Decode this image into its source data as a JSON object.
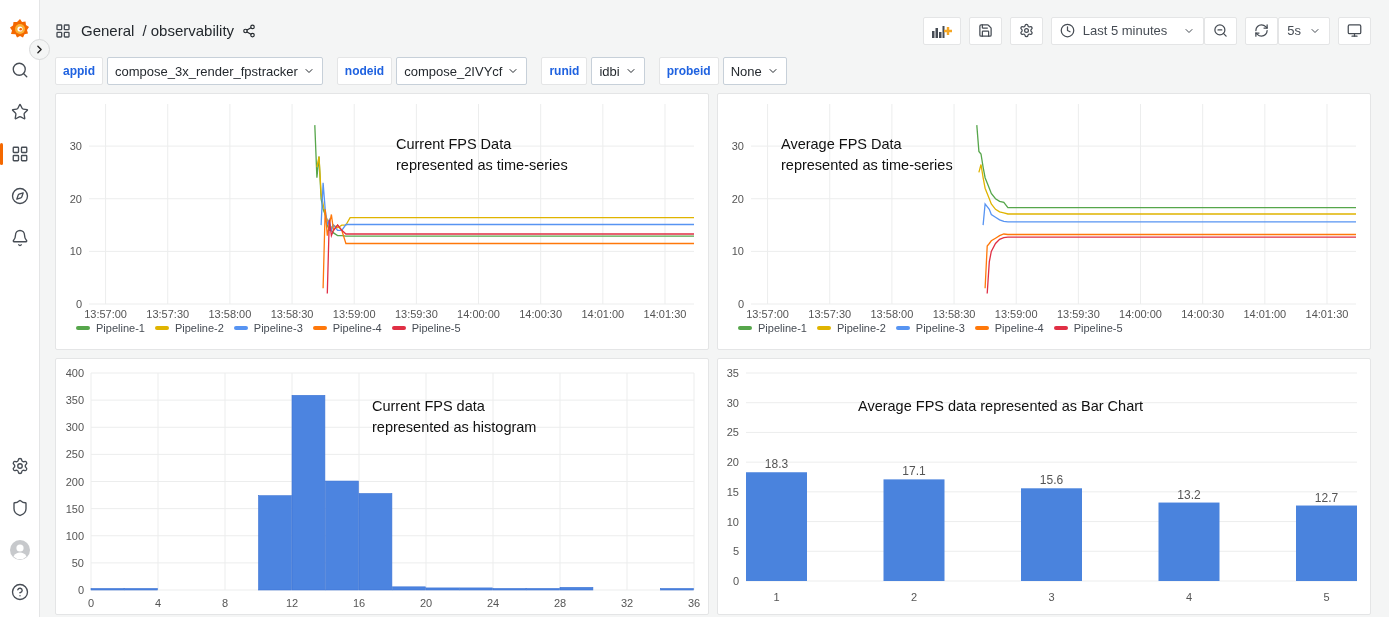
{
  "sidebar": {
    "items": [
      {
        "kind": "search",
        "selected": false
      },
      {
        "kind": "starred",
        "selected": false
      },
      {
        "kind": "dashboards",
        "selected": true
      },
      {
        "kind": "explore",
        "selected": false
      },
      {
        "kind": "alerting",
        "selected": false
      }
    ],
    "bottom_items": [
      {
        "kind": "settings"
      },
      {
        "kind": "shield"
      },
      {
        "kind": "profile"
      },
      {
        "kind": "help"
      }
    ]
  },
  "header": {
    "folder": "General",
    "dashboard": "/ observability"
  },
  "toolbar": {
    "time_range": "Last 5 minutes",
    "refresh_interval": "5s"
  },
  "variables": [
    {
      "name": "appid",
      "value": "compose_3x_render_fpstracker"
    },
    {
      "name": "nodeid",
      "value": "compose_2IVYcf"
    },
    {
      "name": "runid",
      "value": "idbi"
    },
    {
      "name": "probeid",
      "value": "None"
    }
  ],
  "panels": [
    {
      "annotation": "Current FPS Data\nrepresented as time-series",
      "chart_data": {
        "type": "line",
        "grid": true,
        "x": [
          50321,
          50322,
          50323,
          50324,
          50325,
          50326,
          50327,
          50328,
          50329,
          50330,
          50332,
          50334,
          50336,
          50338,
          50340,
          50504
        ],
        "xlim": [
          50212,
          50504
        ],
        "ylim": [
          0,
          38
        ],
        "yticks": [
          0,
          10,
          20,
          30
        ],
        "xticks": [
          {
            "value": 50220,
            "label": "13:57:00"
          },
          {
            "value": 50250,
            "label": "13:57:30"
          },
          {
            "value": 50280,
            "label": "13:58:00"
          },
          {
            "value": 50310,
            "label": "13:58:30"
          },
          {
            "value": 50340,
            "label": "13:59:00"
          },
          {
            "value": 50370,
            "label": "13:59:30"
          },
          {
            "value": 50400,
            "label": "14:00:00"
          },
          {
            "value": 50430,
            "label": "14:00:30"
          },
          {
            "value": 50460,
            "label": "14:01:00"
          },
          {
            "value": 50490,
            "label": "14:01:30"
          }
        ],
        "series": [
          {
            "name": "Pipeline-1",
            "color": "#56a64b",
            "values": [
              34,
              24,
              28,
              20,
              18,
              17,
              15,
              14,
              14,
              13.5,
              13,
              13,
              12.9,
              12.9,
              12.9,
              12.9
            ]
          },
          {
            "name": "Pipeline-2",
            "color": "#e0b400",
            "values": [
              null,
              26,
              28,
              21,
              19,
              17,
              16,
              15,
              14.5,
              15,
              14.5,
              15,
              15,
              16.4,
              16.4,
              16.4
            ]
          },
          {
            "name": "Pipeline-3",
            "color": "#5794f2",
            "values": [
              null,
              null,
              null,
              15,
              23,
              18,
              15,
              16,
              14,
              15,
              14,
              14,
              15.1,
              15.1,
              15.1,
              15.1
            ]
          },
          {
            "name": "Pipeline-4",
            "color": "#ff780a",
            "values": [
              null,
              null,
              null,
              null,
              3,
              18,
              13,
              15,
              17,
              14,
              15,
              14,
              11.5,
              11.5,
              11.5,
              11.5
            ]
          },
          {
            "name": "Pipeline-5",
            "color": "#e02f44",
            "values": [
              null,
              null,
              null,
              null,
              null,
              null,
              2,
              16,
              13,
              14,
              15,
              14,
              13.3,
              13.3,
              13.3,
              13.3
            ]
          }
        ]
      }
    },
    {
      "annotation": "Average FPS Data\nrepresented as time-series",
      "chart_data": {
        "type": "line",
        "grid": true,
        "x": [
          50321,
          50322,
          50323,
          50324,
          50325,
          50326,
          50327,
          50328,
          50330,
          50332,
          50334,
          50336,
          50338,
          50504
        ],
        "xlim": [
          50212,
          50504
        ],
        "ylim": [
          0,
          38
        ],
        "yticks": [
          0,
          10,
          20,
          30
        ],
        "xticks": [
          {
            "value": 50220,
            "label": "13:57:00"
          },
          {
            "value": 50250,
            "label": "13:57:30"
          },
          {
            "value": 50280,
            "label": "13:58:00"
          },
          {
            "value": 50310,
            "label": "13:58:30"
          },
          {
            "value": 50340,
            "label": "13:59:00"
          },
          {
            "value": 50370,
            "label": "13:59:30"
          },
          {
            "value": 50400,
            "label": "14:00:00"
          },
          {
            "value": 50430,
            "label": "14:00:30"
          },
          {
            "value": 50460,
            "label": "14:01:00"
          },
          {
            "value": 50490,
            "label": "14:01:30"
          }
        ],
        "series": [
          {
            "name": "Pipeline-1",
            "color": "#56a64b",
            "values": [
              34,
              29,
              28.5,
              26,
              24,
              23,
              22,
              21,
              20,
              19.5,
              19.3,
              18.3,
              18.3,
              18.3
            ]
          },
          {
            "name": "Pipeline-2",
            "color": "#e0b400",
            "values": [
              null,
              25,
              26.5,
              24,
              22,
              21,
              20,
              19,
              18,
              17.5,
              17.3,
              17.1,
              17.1,
              17.1
            ]
          },
          {
            "name": "Pipeline-3",
            "color": "#5794f2",
            "values": [
              null,
              null,
              null,
              15,
              19,
              18.5,
              18,
              17,
              16.5,
              16,
              15.7,
              15.6,
              15.6,
              15.6
            ]
          },
          {
            "name": "Pipeline-4",
            "color": "#ff780a",
            "values": [
              null,
              null,
              null,
              null,
              3,
              11,
              11.5,
              12,
              12.5,
              13,
              13.3,
              13.2,
              13.2,
              13.2
            ]
          },
          {
            "name": "Pipeline-5",
            "color": "#e02f44",
            "values": [
              null,
              null,
              null,
              null,
              null,
              2,
              8,
              10,
              11.5,
              12.3,
              12.6,
              12.7,
              12.7,
              12.7
            ]
          }
        ]
      }
    },
    {
      "annotation": "Current FPS data\nrepresented as histogram",
      "chart_data": {
        "type": "bar",
        "grid": true,
        "x": [
          1,
          3,
          11,
          13,
          15,
          17,
          19,
          21,
          23,
          25,
          27,
          29,
          35
        ],
        "values": [
          1,
          1,
          172,
          357,
          199,
          176,
          4,
          2,
          2,
          1,
          1,
          3,
          1
        ],
        "xlim": [
          0,
          36
        ],
        "ylim": [
          0,
          400
        ],
        "xticks": [
          0,
          4,
          8,
          12,
          16,
          20,
          24,
          28,
          32,
          36
        ],
        "yticks": [
          0,
          50,
          100,
          150,
          200,
          250,
          300,
          350,
          400
        ]
      }
    },
    {
      "annotation": "Average FPS data represented as Bar Chart",
      "chart_data": {
        "type": "bar",
        "grid": true,
        "categories": [
          "1",
          "2",
          "3",
          "4",
          "5"
        ],
        "values": [
          18.3,
          17.1,
          15.6,
          13.2,
          12.7
        ],
        "value_labels": [
          "18.3",
          "17.1",
          "15.6",
          "13.2",
          "12.7"
        ],
        "ylim": [
          0,
          35
        ],
        "yticks": [
          0,
          5,
          10,
          15,
          20,
          25,
          30,
          35
        ]
      }
    }
  ]
}
